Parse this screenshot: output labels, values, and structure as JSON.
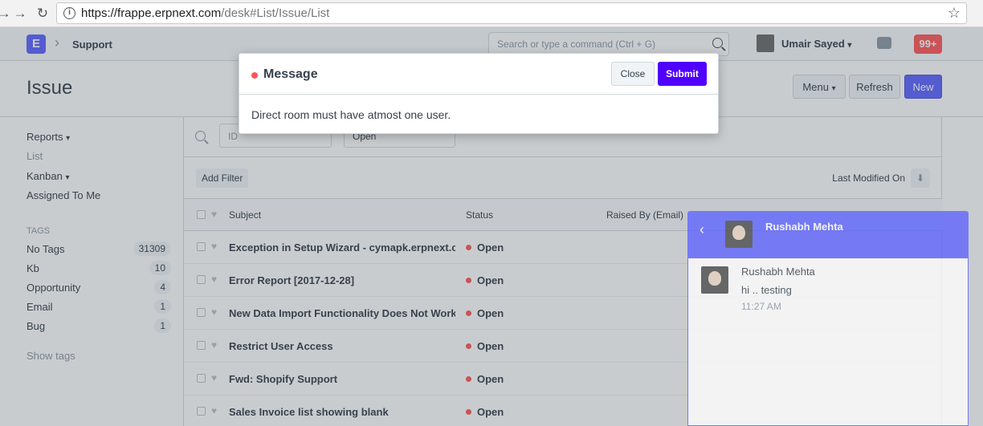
{
  "browser": {
    "url_host": "https://frappe.erpnext.com",
    "url_path": "/desk#List/Issue/List"
  },
  "navbar": {
    "app_logo": "E",
    "breadcrumb": "Support",
    "search_placeholder": "Search or type a command (Ctrl + G)",
    "user_name": "Umair Sayed",
    "notification_count": "99+"
  },
  "page": {
    "title": "Issue",
    "menu_label": "Menu",
    "refresh_label": "Refresh",
    "new_label": "New"
  },
  "sidebar": {
    "links": [
      "Reports",
      "List",
      "Kanban",
      "Assigned To Me"
    ],
    "tags_heading": "TAGS",
    "tags": [
      {
        "name": "No Tags",
        "count": "31309"
      },
      {
        "name": "Kb",
        "count": "10"
      },
      {
        "name": "Opportunity",
        "count": "4"
      },
      {
        "name": "Email",
        "count": "1"
      },
      {
        "name": "Bug",
        "count": "1"
      }
    ],
    "show_tags": "Show tags"
  },
  "filters": {
    "id_placeholder": "ID",
    "status_value": "Open",
    "add_filter": "Add Filter",
    "sort_label": "Last Modified On"
  },
  "list": {
    "columns": [
      "Subject",
      "Status",
      "Raised By (Email)"
    ],
    "rows": [
      {
        "subject": "Exception in Setup Wizard - cymapk.erpnext.com",
        "status": "Open"
      },
      {
        "subject": "Error Report [2017-12-28]",
        "status": "Open"
      },
      {
        "subject": "New Data Import Functionality Does Not Work",
        "status": "Open"
      },
      {
        "subject": "Restrict User Access",
        "status": "Open"
      },
      {
        "subject": "Fwd: Shopify Support",
        "status": "Open"
      },
      {
        "subject": "Sales Invoice list showing blank",
        "status": "Open"
      }
    ]
  },
  "chat": {
    "contact_name": "Rushabh Mehta",
    "message_sender": "Rushabh Mehta",
    "message_text": "hi .. testing",
    "message_time": "11:27 AM"
  },
  "modal": {
    "title": "Message",
    "close_label": "Close",
    "submit_label": "Submit",
    "body": "Direct room must have atmost one user."
  },
  "colors": {
    "primary": "#5e64ff",
    "submit": "#5000ff",
    "status_open": "#ff5858"
  }
}
